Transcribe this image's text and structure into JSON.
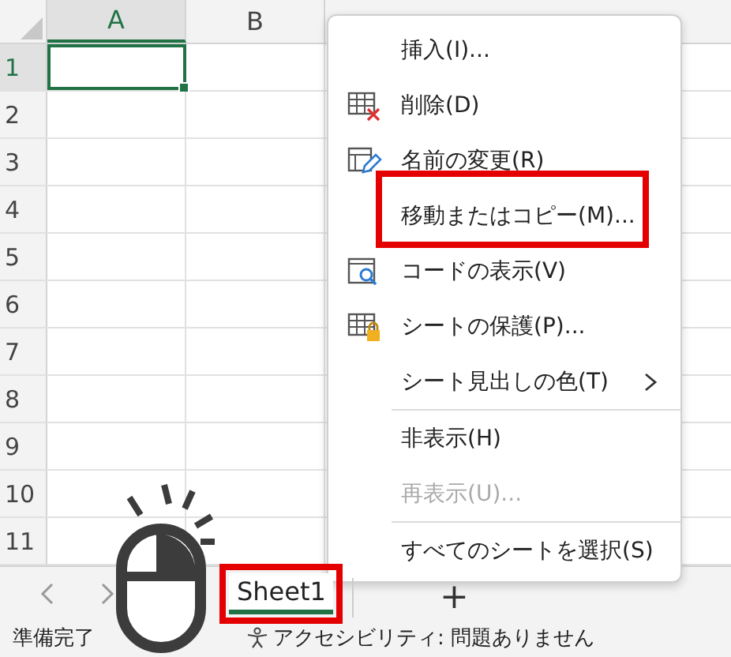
{
  "columns": [
    {
      "label": "A",
      "selected": true
    },
    {
      "label": "B",
      "selected": false
    }
  ],
  "rows": [
    {
      "label": "1",
      "selected": true
    },
    {
      "label": "2",
      "selected": false
    },
    {
      "label": "3",
      "selected": false
    },
    {
      "label": "4",
      "selected": false
    },
    {
      "label": "5",
      "selected": false
    },
    {
      "label": "6",
      "selected": false
    },
    {
      "label": "7",
      "selected": false
    },
    {
      "label": "8",
      "selected": false
    },
    {
      "label": "9",
      "selected": false
    },
    {
      "label": "10",
      "selected": false
    },
    {
      "label": "11",
      "selected": false
    }
  ],
  "context_menu": {
    "items": [
      {
        "kind": "item",
        "label": "挿入(I)...",
        "disabled": false,
        "highlighted": false
      },
      {
        "kind": "item",
        "label": "削除(D)",
        "disabled": false,
        "highlighted": false
      },
      {
        "kind": "item",
        "label": "名前の変更(R)",
        "disabled": false,
        "highlighted": false
      },
      {
        "kind": "item",
        "label": "移動またはコピー(M)...",
        "disabled": false,
        "highlighted": true
      },
      {
        "kind": "item",
        "label": "コードの表示(V)",
        "disabled": false,
        "highlighted": false
      },
      {
        "kind": "item",
        "label": "シートの保護(P)...",
        "disabled": false,
        "highlighted": false
      },
      {
        "kind": "submenu",
        "label": "シート見出しの色(T)",
        "disabled": false,
        "highlighted": false
      },
      {
        "kind": "separator"
      },
      {
        "kind": "item",
        "label": "非表示(H)",
        "disabled": false,
        "highlighted": false
      },
      {
        "kind": "item",
        "label": "再表示(U)...",
        "disabled": true,
        "highlighted": false
      },
      {
        "kind": "separator"
      },
      {
        "kind": "item",
        "label": "すべてのシートを選択(S)",
        "disabled": false,
        "highlighted": false
      }
    ]
  },
  "sheet_tabs": [
    {
      "label": "Sheet1",
      "selected": true,
      "highlighted": true
    }
  ],
  "add_sheet": "+",
  "status_bar": {
    "mode": "準備完了",
    "accessibility": "アクセシビリティ: 問題ありません"
  }
}
